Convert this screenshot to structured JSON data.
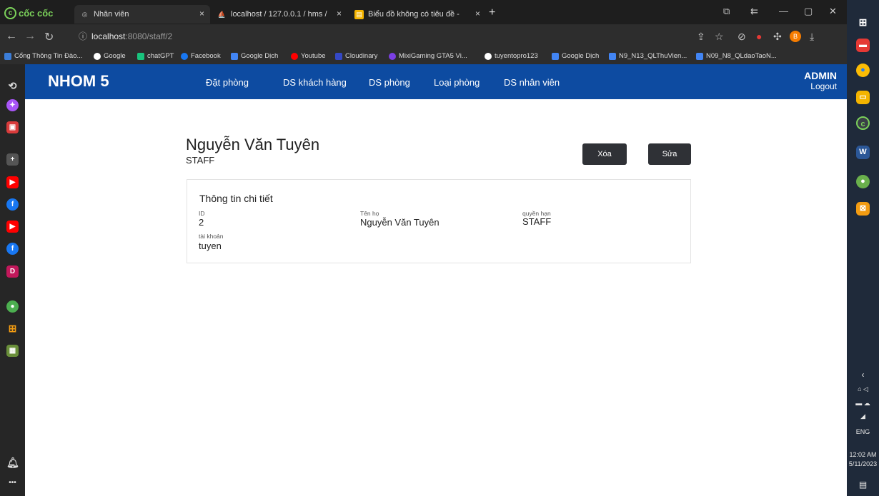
{
  "browser": {
    "brand": "cốc cốc",
    "tabs": [
      {
        "label": "Nhân viên",
        "close": "×"
      },
      {
        "label": "localhost / 127.0.0.1 / hms / ",
        "close": "×"
      },
      {
        "label": "Biểu đồ không có tiêu đề - ",
        "close": "×"
      }
    ],
    "new_tab": "+",
    "url_host": "localhost",
    "url_rest": ":8080/staff/2",
    "bookmarks": [
      {
        "label": "Cổng Thông Tin Đào...",
        "color": "#3b7dd8"
      },
      {
        "label": "Google",
        "color": "#ffffff"
      },
      {
        "label": "chatGPT",
        "color": "#19c37d"
      },
      {
        "label": "Facebook",
        "color": "#1877f2"
      },
      {
        "label": "Google Dịch",
        "color": "#4285f4"
      },
      {
        "label": "Youtube",
        "color": "#ff0000"
      },
      {
        "label": "Cloudinary",
        "color": "#3448c5"
      },
      {
        "label": "MixiGaming GTA5 Vi...",
        "color": "#7b3fe4"
      },
      {
        "label": "tuyentopro123",
        "color": "#ffffff"
      },
      {
        "label": "Google Dịch",
        "color": "#4285f4"
      },
      {
        "label": "N9_N13_QLThuVien...",
        "color": "#4285f4"
      },
      {
        "label": "N09_N8_QLdaoTaoN...",
        "color": "#4285f4"
      }
    ]
  },
  "app": {
    "brand": "NHOM 5",
    "nav": [
      "Đặt phòng",
      "DS khách hàng",
      "DS phòng",
      "Loại phòng",
      "DS nhân viên"
    ],
    "user": "ADMIN",
    "logout": "Logout"
  },
  "staff": {
    "name": "Nguyễn Văn Tuyên",
    "role": "STAFF",
    "delete_label": "Xóa",
    "edit_label": "Sửa",
    "details_title": "Thông tin chi tiết",
    "fields": {
      "id_label": "ID",
      "id_value": "2",
      "name_label": "Tên họ",
      "name_value": "Nguyễn Văn Tuyên",
      "role_label": "quyền hạn",
      "role_value": "STAFF",
      "account_label": "tài khoản",
      "account_value": "tuyen"
    }
  },
  "taskbar": {
    "lang": "ENG",
    "time": "12:02 AM",
    "date": "5/11/2023"
  },
  "colors": {
    "navbar": "#0d4ba1",
    "button": "#2f3136"
  }
}
